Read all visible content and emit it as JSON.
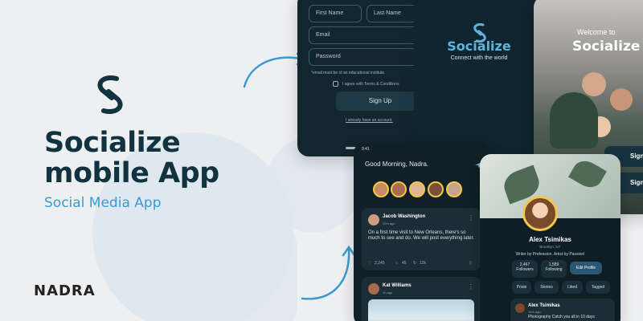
{
  "hero": {
    "title_line1": "Socialize",
    "title_line2": "mobile App",
    "subtitle": "Social Media App"
  },
  "brand": "NADRA",
  "signup_screen": {
    "first_name_placeholder": "First Name",
    "last_name_placeholder": "Last Name",
    "email_placeholder": "Email",
    "password_placeholder": "Password",
    "edu_note": "*email must be of an educational institute",
    "terms_label": "I agree with Terms & Conditions",
    "signup_button": "Sign Up",
    "login_link": "I already have an account."
  },
  "splash_screen": {
    "title": "Socialize",
    "tagline": "Connect with the world"
  },
  "welcome_screen": {
    "welcome": "Welcome to",
    "title": "Socialize",
    "signin_button": "Sign",
    "signup_button": "Sign"
  },
  "feed_screen": {
    "time": "9:41",
    "greeting": "Good Morning, Nadra.",
    "post1": {
      "author": "Jacob Washington",
      "meta": "20m ago",
      "text": "On a first time visit to New Orleans, there's so much to see and do. We will post everything later.",
      "likes": "2,245",
      "comments": "45",
      "shares": "12k"
    },
    "post2": {
      "author": "Kat Williams",
      "meta": "1h ago"
    }
  },
  "profile_screen": {
    "name": "Alex Tsimikas",
    "location": "Brooklyn, NY",
    "bio": "Writer by Profession. Artist by Passion!",
    "followers_count": "2,467",
    "followers_label": "Followers",
    "following_count": "1,589",
    "following_label": "Following",
    "edit_profile": "Edit Profile",
    "tabs": [
      "Posts",
      "Stories",
      "Liked",
      "Tagged"
    ],
    "post_author": "Alex Tsimikas",
    "post_meta": "15m ago",
    "post_text": "Photography Catch you all in 10 days"
  },
  "colors": {
    "dark_navy": "#11323f",
    "accent_blue": "#3a9bd0",
    "phone_bg": "#132630",
    "story_ring": "#f1c84b"
  }
}
